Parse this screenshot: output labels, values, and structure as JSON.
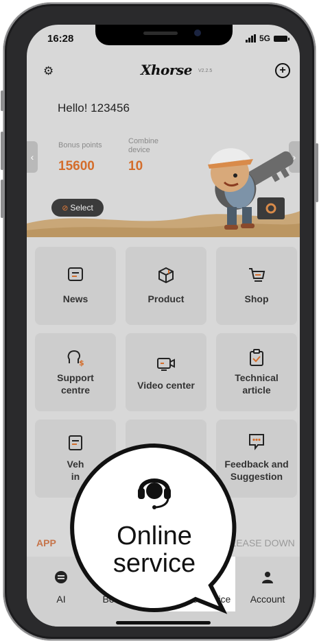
{
  "status": {
    "time": "16:28",
    "network": "5G"
  },
  "header": {
    "logo": "Xhorse",
    "version": "V2.2.5",
    "settings_icon": "gear-icon",
    "add_icon": "plus-circle-icon"
  },
  "greeting": "Hello! 123456",
  "stats": {
    "bonus_label": "Bonus points",
    "bonus_value": "15600",
    "combine_label_line1": "Combine",
    "combine_label_line2": "device",
    "combine_value": "10"
  },
  "select_label": "Select",
  "grid": [
    {
      "label": "News",
      "icon": "news-icon"
    },
    {
      "label": "Product",
      "icon": "product-box-icon"
    },
    {
      "label": "Shop",
      "icon": "cart-icon"
    },
    {
      "label1": "Support",
      "label2": "centre",
      "icon": "support-icon"
    },
    {
      "label": "Video center",
      "icon": "video-camera-icon"
    },
    {
      "label1": "Technical",
      "label2": "article",
      "icon": "clipboard-check-icon"
    },
    {
      "label1": "Veh",
      "label2": "in",
      "icon": "vehicle-doc-icon"
    },
    {
      "label1": "Feedback and",
      "label2": "Suggestion",
      "icon": "chat-dots-icon"
    }
  ],
  "notice": {
    "left": "APP",
    "right": "APP,PLEASE DOWN"
  },
  "tabs": [
    {
      "label": "AI",
      "icon": "ai-icon"
    },
    {
      "label": "Bonus points",
      "icon": "bonus-icon"
    },
    {
      "label": "Online service",
      "icon": "headset-icon"
    },
    {
      "label": "Account",
      "icon": "person-icon"
    }
  ],
  "callout": {
    "line1": "Online",
    "line2": "service",
    "icon": "headset-icon"
  },
  "colors": {
    "accent": "#d46d2b",
    "overlay": "#d8d8d8",
    "tile": "#cdcdcd"
  }
}
